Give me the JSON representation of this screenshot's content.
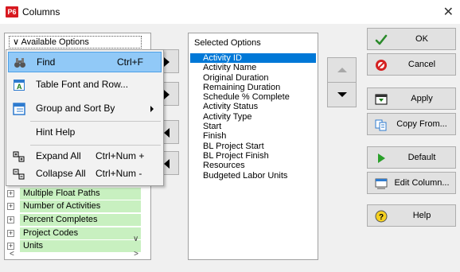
{
  "window": {
    "title": "Columns",
    "app_icon_text": "P6"
  },
  "available": {
    "header": "Available Options",
    "tree_items": [
      "Multiple Float Paths",
      "Number of Activities",
      "Percent Completes",
      "Project Codes",
      "Units"
    ]
  },
  "context_menu": {
    "items": [
      {
        "label": "Find",
        "shortcut": "Ctrl+F"
      },
      {
        "label": "Table Font and Row..."
      },
      {
        "label": "Group and Sort By"
      },
      {
        "label": "Hint Help"
      },
      {
        "label": "Expand All",
        "shortcut": "Ctrl+Num +"
      },
      {
        "label": "Collapse All",
        "shortcut": "Ctrl+Num -"
      }
    ]
  },
  "selected": {
    "header": "Selected Options",
    "items": [
      "Activity ID",
      "Activity Name",
      "Original Duration",
      "Remaining Duration",
      "Schedule % Complete",
      "Activity Status",
      "Activity Type",
      "Start",
      "Finish",
      "BL Project Start",
      "BL Project Finish",
      "Resources",
      "Budgeted Labor Units"
    ]
  },
  "buttons": {
    "ok": "OK",
    "cancel": "Cancel",
    "apply": "Apply",
    "copy_from": "Copy From...",
    "default": "Default",
    "edit_column": "Edit Column...",
    "help": "Help"
  },
  "colors": {
    "selection": "#0078d7",
    "menu_highlight": "#91c9f7",
    "tree_green": "#c8f0c0"
  }
}
